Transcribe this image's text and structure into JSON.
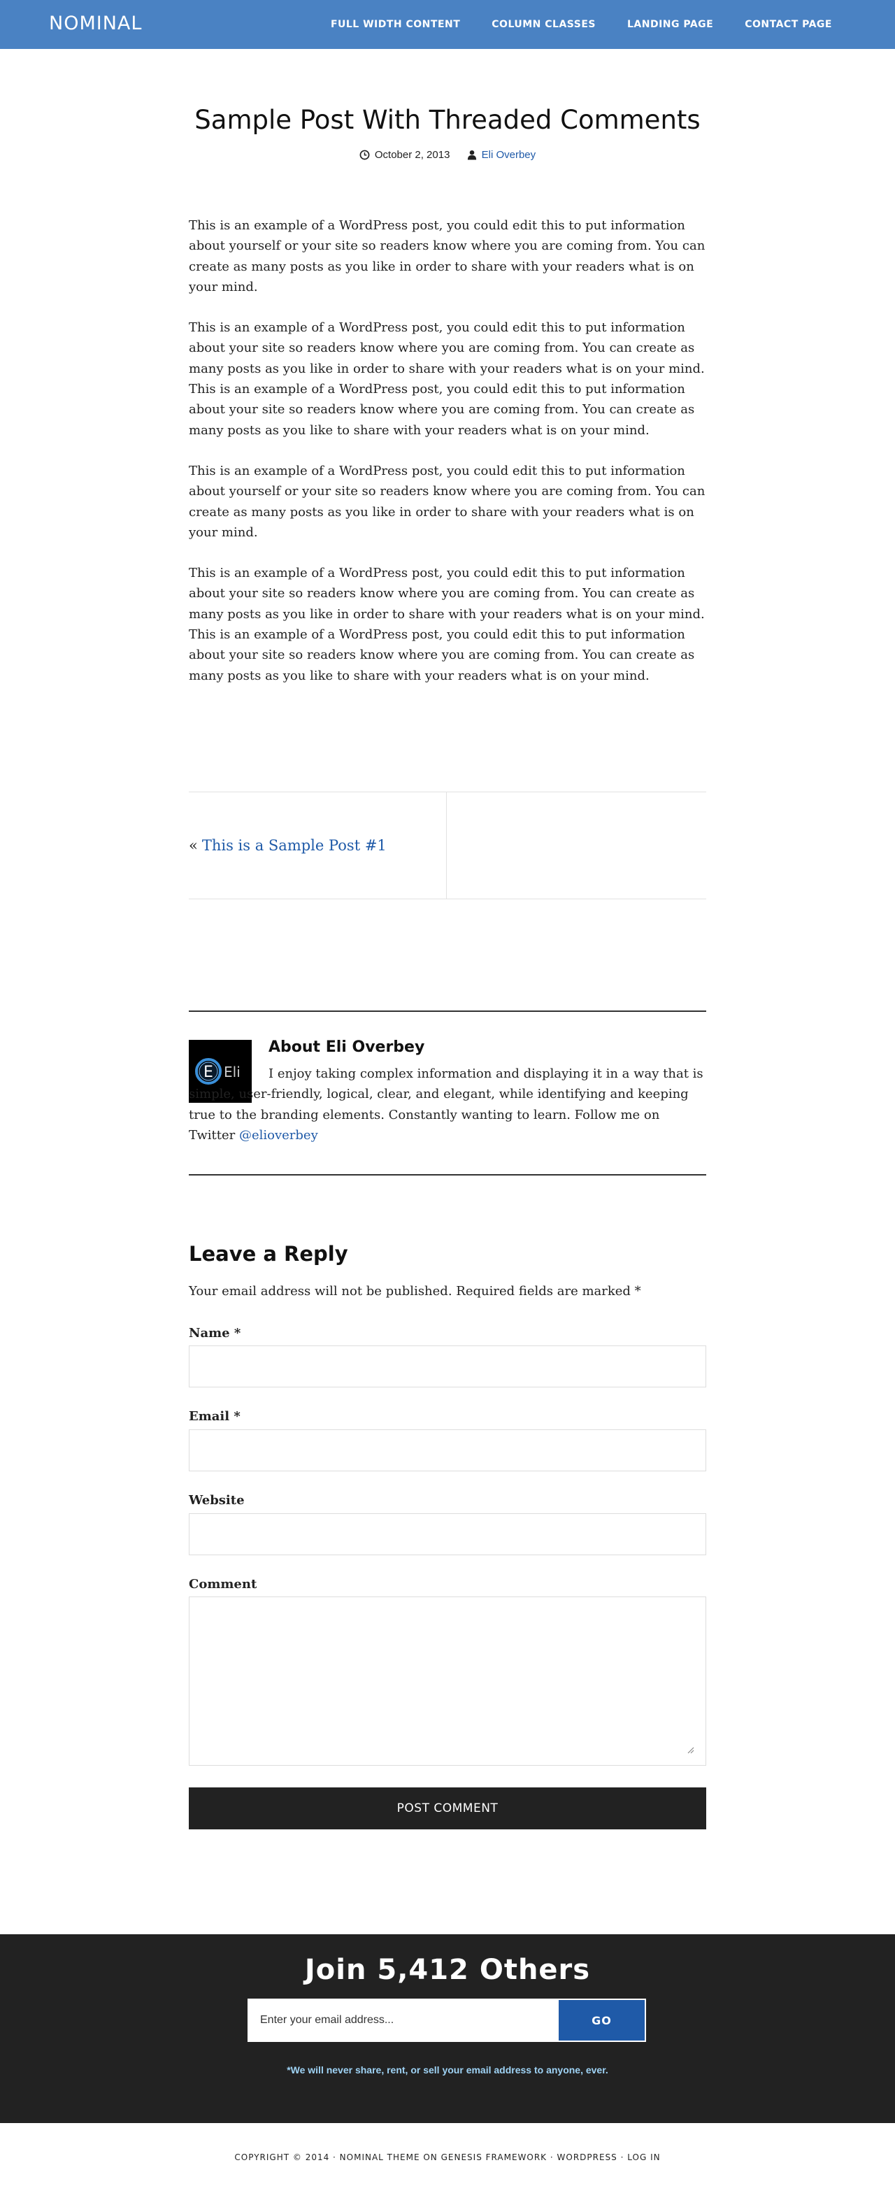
{
  "header": {
    "site_title": "NOMINAL",
    "nav": [
      {
        "label": "FULL WIDTH CONTENT"
      },
      {
        "label": "COLUMN CLASSES"
      },
      {
        "label": "LANDING PAGE"
      },
      {
        "label": "CONTACT PAGE"
      }
    ],
    "background_color": "#4a82c3"
  },
  "post": {
    "title": "Sample Post With Threaded Comments",
    "date": "October 2, 2013",
    "author": "Eli Overbey",
    "paragraphs": [
      "This is an example of a WordPress post, you could edit this to put information about yourself or your site so readers know where you are coming from. You can create as many posts as you like in order to share with your readers what is on your mind.",
      "This is an example of a WordPress post, you could edit this to put information about your site so readers know where you are coming from. You can create as many posts as you like in order to share with your readers what is on your mind. This is an example of a WordPress post, you could edit this to put information about your site so readers know where you are coming from. You can create as many posts as you like to share with your readers what is on your mind.",
      "This is an example of a WordPress post, you could edit this to put information about yourself or your site so readers know where you are coming from. You can create as many posts as you like in order to share with your readers what is on your mind.",
      "This is an example of a WordPress post, you could edit this to put information about your site so readers know where you are coming from. You can create as many posts as you like in order to share with your readers what is on your mind. This is an example of a WordPress post, you could edit this to put information about your site so readers know where you are coming from. You can create as many posts as you like to share with your readers what is on your mind."
    ]
  },
  "post_nav": {
    "prev_arrow": "«",
    "prev_label": "This is a Sample Post #1"
  },
  "author_box": {
    "title": "About Eli Overbey",
    "avatar_letter": "E",
    "avatar_text": "Eli",
    "description": "I enjoy taking complex information and displaying it in a way that is simple, user-friendly, logical, clear, and elegant, while identifying and keeping true to the branding elements. Constantly wanting to learn. Follow me on Twitter ",
    "twitter_handle": "@elioverbey"
  },
  "reply": {
    "title": "Leave a Reply",
    "notes": "Your email address will not be published. Required fields are marked *",
    "name_label": "Name *",
    "email_label": "Email *",
    "website_label": "Website",
    "comment_label": "Comment",
    "submit_label": "POST COMMENT"
  },
  "newsletter": {
    "title": "Join 5,412 Others",
    "placeholder": "Enter your email address...",
    "button_label": "GO",
    "note": "*We will never share, rent, or sell your email address to anyone, ever."
  },
  "footer": {
    "copyright": "COPYRIGHT © 2014 · NOMINAL THEME ON ",
    "genesis": "GENESIS FRAMEWORK",
    "sep1": " · ",
    "wordpress": "WORDPRESS",
    "sep2": " · ",
    "login": "LOG IN"
  },
  "colors": {
    "accent": "#1f5aa8",
    "dark": "#222222",
    "note": "#9fd3f5"
  }
}
